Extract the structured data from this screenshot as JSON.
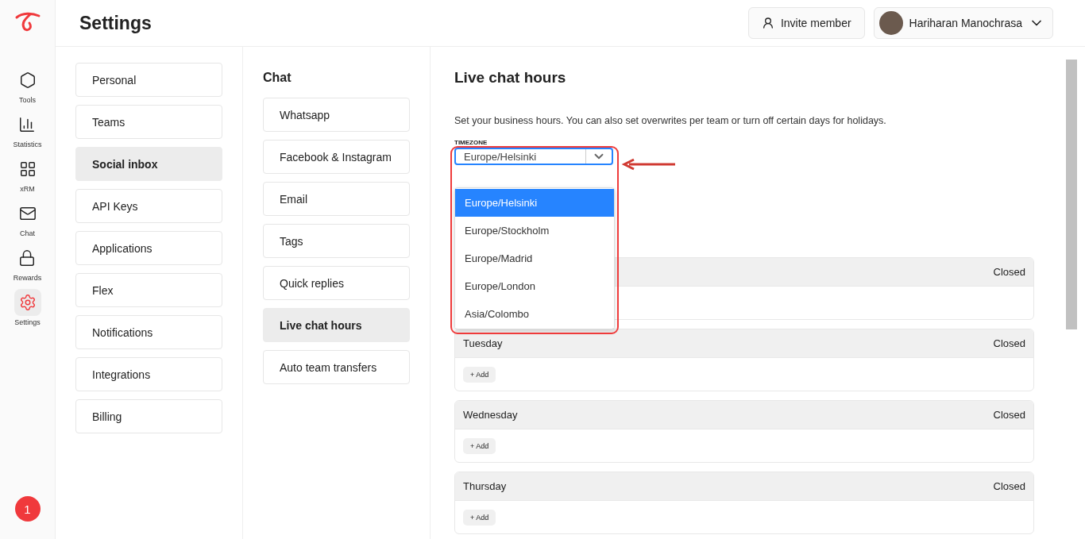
{
  "header": {
    "title": "Settings",
    "invite_button": "Invite member",
    "user_name": "Hariharan Manochrasa"
  },
  "rail": [
    {
      "label": "Tools",
      "selected": false
    },
    {
      "label": "Statistics",
      "selected": false
    },
    {
      "label": "xRM",
      "selected": false
    },
    {
      "label": "Chat",
      "selected": false
    },
    {
      "label": "Rewards",
      "selected": false
    },
    {
      "label": "Settings",
      "selected": true
    }
  ],
  "notification_badge": "1",
  "settings_menu": [
    {
      "label": "Personal",
      "selected": false
    },
    {
      "label": "Teams",
      "selected": false
    },
    {
      "label": "Social inbox",
      "selected": true
    },
    {
      "label": "API Keys",
      "selected": false
    },
    {
      "label": "Applications",
      "selected": false
    },
    {
      "label": "Flex",
      "selected": false
    },
    {
      "label": "Notifications",
      "selected": false
    },
    {
      "label": "Integrations",
      "selected": false
    },
    {
      "label": "Billing",
      "selected": false
    }
  ],
  "sub_menu": {
    "heading": "Chat",
    "items": [
      {
        "label": "Whatsapp",
        "selected": false
      },
      {
        "label": "Facebook & Instagram",
        "selected": false
      },
      {
        "label": "Email",
        "selected": false
      },
      {
        "label": "Tags",
        "selected": false
      },
      {
        "label": "Quick replies",
        "selected": false
      },
      {
        "label": "Live chat hours",
        "selected": true
      },
      {
        "label": "Auto team transfers",
        "selected": false
      }
    ]
  },
  "content": {
    "title": "Live chat hours",
    "description": "Set your business hours. You can also set overwrites per team or turn off certain days for holidays.",
    "timezone_label": "TIMEZONE",
    "timezone_value": "Europe/Helsinki",
    "timezone_options": [
      {
        "label": "Europe/Helsinki",
        "selected": true
      },
      {
        "label": "Europe/Stockholm",
        "selected": false
      },
      {
        "label": "Europe/Madrid",
        "selected": false
      },
      {
        "label": "Europe/London",
        "selected": false
      },
      {
        "label": "Asia/Colombo",
        "selected": false
      }
    ],
    "days": [
      {
        "status": "Closed"
      },
      {
        "name": "Tuesday",
        "status": "Closed",
        "add_label": "+ Add"
      },
      {
        "name": "Wednesday",
        "status": "Closed",
        "add_label": "+ Add"
      },
      {
        "name": "Thursday",
        "status": "Closed",
        "add_label": "+ Add"
      }
    ]
  }
}
